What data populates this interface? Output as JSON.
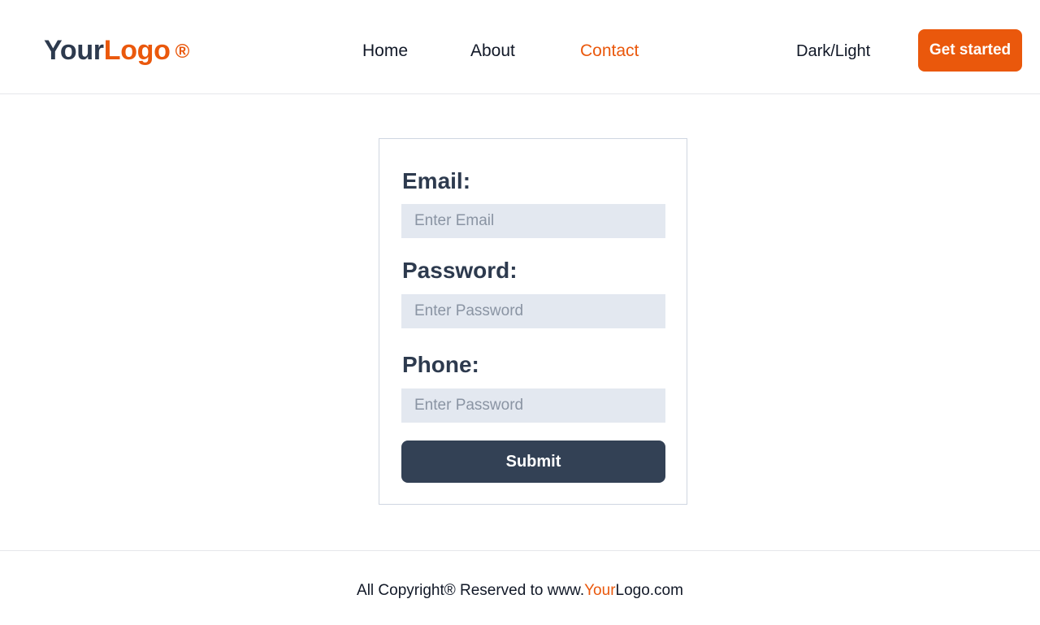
{
  "header": {
    "logo": {
      "part_1": "Your",
      "part_2": "Logo",
      "mark": "®"
    },
    "nav": {
      "home": "Home",
      "about": "About",
      "contact": "Contact"
    },
    "theme_toggle_label": "Dark/Light",
    "cta_label": "Get started"
  },
  "form": {
    "email_label": "Email:",
    "email_placeholder": "Enter Email",
    "password_label": "Password:",
    "password_placeholder": "Enter Password",
    "phone_label": "Phone:",
    "phone_placeholder": "Enter Password",
    "submit_label": "Submit"
  },
  "footer": {
    "text_before": "All Copyright® Reserved to www.",
    "text_accent": "Your",
    "text_after": "Logo.com"
  },
  "colors": {
    "accent": "#ea580c",
    "heading": "#2d3a4e",
    "button_dark": "#334155",
    "input_bg": "#e3e8f0"
  }
}
